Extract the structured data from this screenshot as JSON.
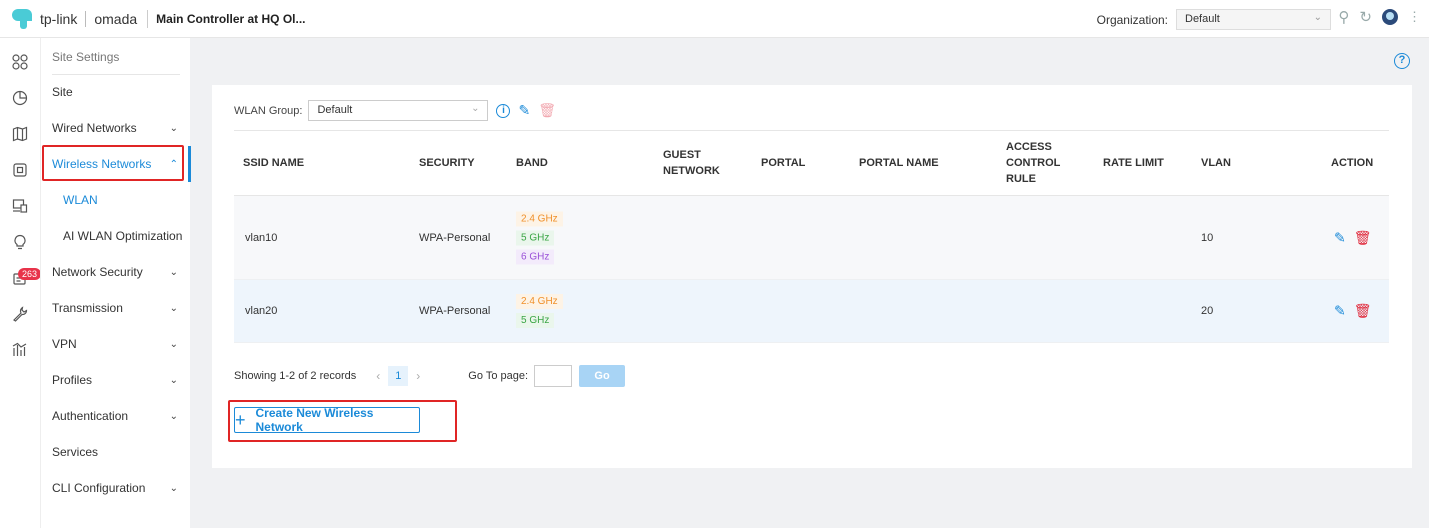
{
  "topbar": {
    "brand": "tp-link",
    "product": "omada",
    "controller_name": "Main Controller at HQ Ol...",
    "org_label": "Organization:",
    "org_value": "Default"
  },
  "rail": {
    "badge_count": "263",
    "icons": [
      "dashboard-icon",
      "statistics-icon",
      "map-icon",
      "devices-icon",
      "clients-icon",
      "insight-icon",
      "logs-icon",
      "tools-icon",
      "reports-icon"
    ]
  },
  "menu": {
    "section_title": "Site Settings",
    "items": [
      {
        "label": "Site"
      },
      {
        "label": "Wired Networks"
      },
      {
        "label": "Wireless Networks"
      },
      {
        "label": "WLAN"
      },
      {
        "label": "AI WLAN Optimization"
      },
      {
        "label": "Network Security"
      },
      {
        "label": "Transmission"
      },
      {
        "label": "VPN"
      },
      {
        "label": "Profiles"
      },
      {
        "label": "Authentication"
      },
      {
        "label": "Services"
      },
      {
        "label": "CLI Configuration"
      }
    ]
  },
  "wlan_group": {
    "label": "WLAN Group:",
    "value": "Default"
  },
  "table": {
    "headers": {
      "ssid": "SSID NAME",
      "security": "SECURITY",
      "band": "BAND",
      "guest_1": "GUEST",
      "guest_2": "NETWORK",
      "portal": "PORTAL",
      "portal_name": "PORTAL NAME",
      "acr_1": "ACCESS",
      "acr_2": "CONTROL",
      "acr_3": "RULE",
      "rate_limit": "RATE LIMIT",
      "vlan": "VLAN",
      "action": "ACTION"
    },
    "rows": [
      {
        "ssid": "vlan10",
        "security": "WPA-Personal",
        "bands": [
          "2.4 GHz",
          "5 GHz",
          "6 GHz"
        ],
        "vlan": "10"
      },
      {
        "ssid": "vlan20",
        "security": "WPA-Personal",
        "bands": [
          "2.4 GHz",
          "5 GHz"
        ],
        "vlan": "20"
      }
    ]
  },
  "pagination": {
    "summary": "Showing 1-2 of 2 records",
    "current_page": "1",
    "goto_label": "Go To page:",
    "go_label": "Go"
  },
  "create_button": {
    "label": "Create New Wireless Network"
  }
}
